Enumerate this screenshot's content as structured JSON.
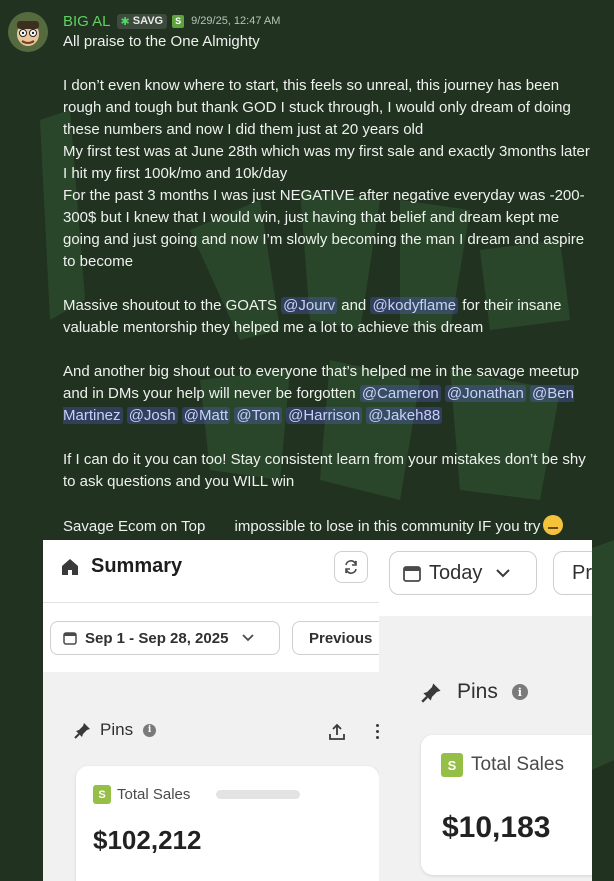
{
  "message": {
    "username": "BIG AL",
    "tag": "SAVG",
    "timestamp": "9/29/25, 12:47 AM",
    "colors": {
      "username": "#5fd15f",
      "mention_bg": "#3b4470",
      "background": "#213221"
    },
    "lines": {
      "l1": "All praise to the One Almighty",
      "p2": "I don’t even know where to start, this feels so unreal, this journey has been rough and tough but thank GOD I stuck through, I would only dream of doing these numbers and now I did them just at 20 years old",
      "p3": "My first test was at June 28th which was my first sale and exactly 3months later I hit my first 100k/mo and 10k/day",
      "p4": "For the past 3 months I was just NEGATIVE after negative everyday was -200-300$ but I knew that I would win, just having that belief and dream kept me going and just going and now I’m slowly becoming the man I dream and aspire to become",
      "p5_a": "Massive shoutout to the GOATS",
      "p5_b": "and",
      "p5_c": "for their insane valuable mentorship they helped me a lot to achieve this dream",
      "p6_a": "And another big shout out to everyone that’s helped me in the savage meetup and in DMs your help will never be forgotten",
      "p7": "If I can do it you can too! Stay consistent learn from your mistakes don’t be shy to ask questions and you WILL win",
      "p8": "Savage Ecom on Top       impossible to lose in this community IF you try"
    },
    "mentions": {
      "jourv": "@Jourv",
      "kodyflame": "@kodyflame",
      "cameron": "@Cameron",
      "jonathan": "@Jonathan",
      "ben": "@Ben Martinez",
      "josh": "@Josh",
      "matt": "@Matt",
      "tom": "@Tom",
      "harrison": "@Harrison",
      "jakeh": "@Jakeh88"
    }
  },
  "screenshot_left": {
    "title": "Summary",
    "date_range": "Sep 1 - Sep 28, 2025",
    "compare_label": "Previous",
    "pins_label": "Pins",
    "card_title": "Total Sales",
    "card_value": "$102,212"
  },
  "screenshot_right": {
    "date_label": "Today",
    "cut_label": "Pr",
    "pins_label": "Pins",
    "card_title": "Total Sales",
    "card_value": "$10,183"
  }
}
